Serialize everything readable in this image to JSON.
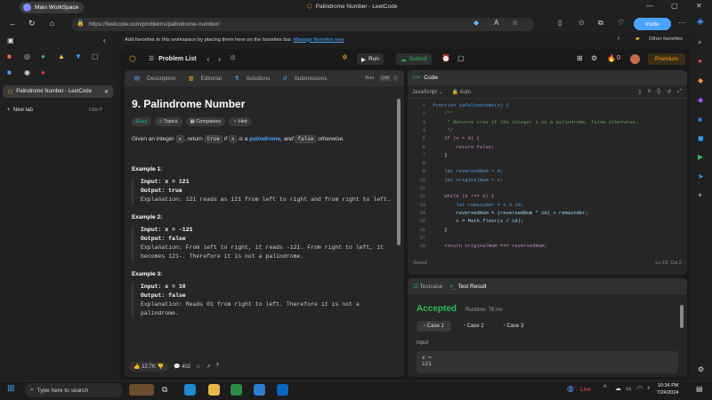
{
  "browser": {
    "workspace": "Main WorkSpace",
    "window_title": "Palindrome Number - LeetCode",
    "url": "https://leetcode.com/problems/palindrome-number/",
    "invite": "Invite",
    "fav_prompt": "Add favorites to this workspace by placing them here on the favorites bar.",
    "fav_link": "Manage favorites now",
    "other_fav": "Other favorites",
    "tab": "Palindrome Number - LeetCode",
    "new_tab": "New tab",
    "new_tab_shortcut": "Ctrl+T"
  },
  "lc": {
    "problem_list": "Problem List",
    "run": "Run",
    "submit": "Submit",
    "streak": "0",
    "premium": "Premium",
    "tabs": {
      "description": "Description",
      "editorial": "Editorial",
      "solutions": "Solutions",
      "submissions": "Submissions"
    },
    "run_hint": "Run",
    "ctrl_hint": "Ctrl",
    "title": "9. Palindrome Number",
    "chips": {
      "easy": "Easy",
      "topics": "Topics",
      "companies": "Companies",
      "hint": "Hint"
    },
    "para": {
      "a": "Given an integer ",
      "x1": "x",
      "b": ", return ",
      "t": "true",
      "c": " if ",
      "x2": "x",
      "d": " is a ",
      "pal": "palindrome",
      "e": ", and ",
      "f": "false",
      "g": " otherwise."
    },
    "examples": [
      {
        "h": "Example 1:",
        "input": "Input: x = 121",
        "output": "Output: true",
        "exp": "Explanation: 121 reads as 121 from left to right and from right to left."
      },
      {
        "h": "Example 2:",
        "input": "Input: x = -121",
        "output": "Output: false",
        "exp": "Explanation: From left to right, it reads -121. From right to left, it becomes 121-. Therefore it is not a palindrome."
      },
      {
        "h": "Example 3:",
        "input": "Input: x = 10",
        "output": "Output: false",
        "exp": "Explanation: Reads 01 from right to left. Therefore it is not a palindrome."
      }
    ],
    "likes": "12.7K",
    "comments": "402",
    "code_title": "Code",
    "lang": "JavaScript",
    "auto": "Auto",
    "code": [
      "function isPalindrome(x) {",
      "    /**",
      "     * Returns true if the integer x is a palindrome, false otherwise.",
      "     */",
      "    if (x < 0) {",
      "        return false;",
      "    }",
      "",
      "    let reversedNum = 0;",
      "    let originalNum = x;",
      "",
      "    while (x !== 0) {",
      "        let remainder = x % 10;",
      "        reversedNum = (reversedNum * 10) + remainder;",
      "        x = Math.floor(x / 10);",
      "    }",
      "",
      "    return originalNum === reversedNum;"
    ],
    "saved": "Saved",
    "cursor": "Ln 19, Col 2",
    "testcase": "Testcase",
    "test_result": "Test Result",
    "accepted": "Accepted",
    "runtime": "Runtime: 78 ms",
    "cases": [
      "Case 1",
      "Case 2",
      "Case 3"
    ],
    "input_label": "Input",
    "input_val": "x =",
    "input_num": "121"
  },
  "taskbar": {
    "search": "Type here to search",
    "live": "Live",
    "time": "10:34 PM",
    "date": "7/24/2024"
  }
}
